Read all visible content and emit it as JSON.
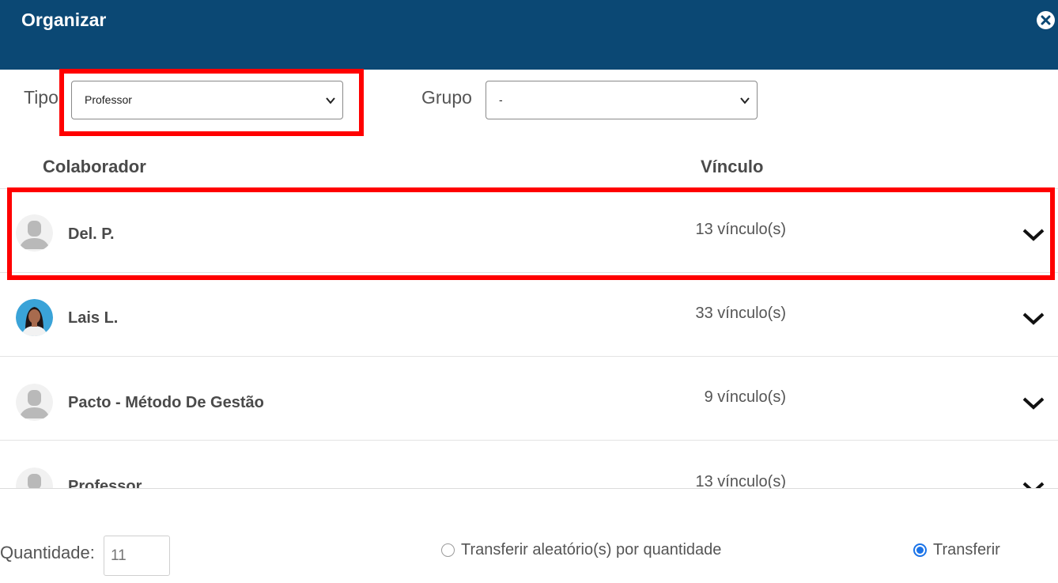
{
  "header": {
    "title": "Organizar"
  },
  "filters": {
    "tipo_label": "Tipo",
    "tipo_value": "Professor",
    "grupo_label": "Grupo",
    "grupo_value": "-"
  },
  "table": {
    "col_colaborador": "Colaborador",
    "col_vinculo": "Vínculo",
    "rows": [
      {
        "name": "Del. P.",
        "vinculo": "13 vínculo(s)",
        "avatar": "person-placeholder-icon"
      },
      {
        "name": "Lais L.",
        "vinculo": "33 vínculo(s)",
        "avatar": "woman-photo"
      },
      {
        "name": "Pacto - Método De Gestão",
        "vinculo": "9 vínculo(s)",
        "avatar": "person-placeholder-icon"
      },
      {
        "name": "Professor",
        "vinculo": "13 vínculo(s)",
        "avatar": "person-placeholder-icon"
      }
    ]
  },
  "footer": {
    "quantidade_label": "Quantidade:",
    "quantidade_placeholder": "11",
    "radio_random_label": "Transferir aleatório(s) por quantidade",
    "radio_random_checked": false,
    "radio_transfer_label": "Transferir",
    "radio_transfer_checked": true
  },
  "colors": {
    "header_bg": "#0b4874",
    "highlight": "#ff0000",
    "radio_accent": "#1a73e8"
  }
}
